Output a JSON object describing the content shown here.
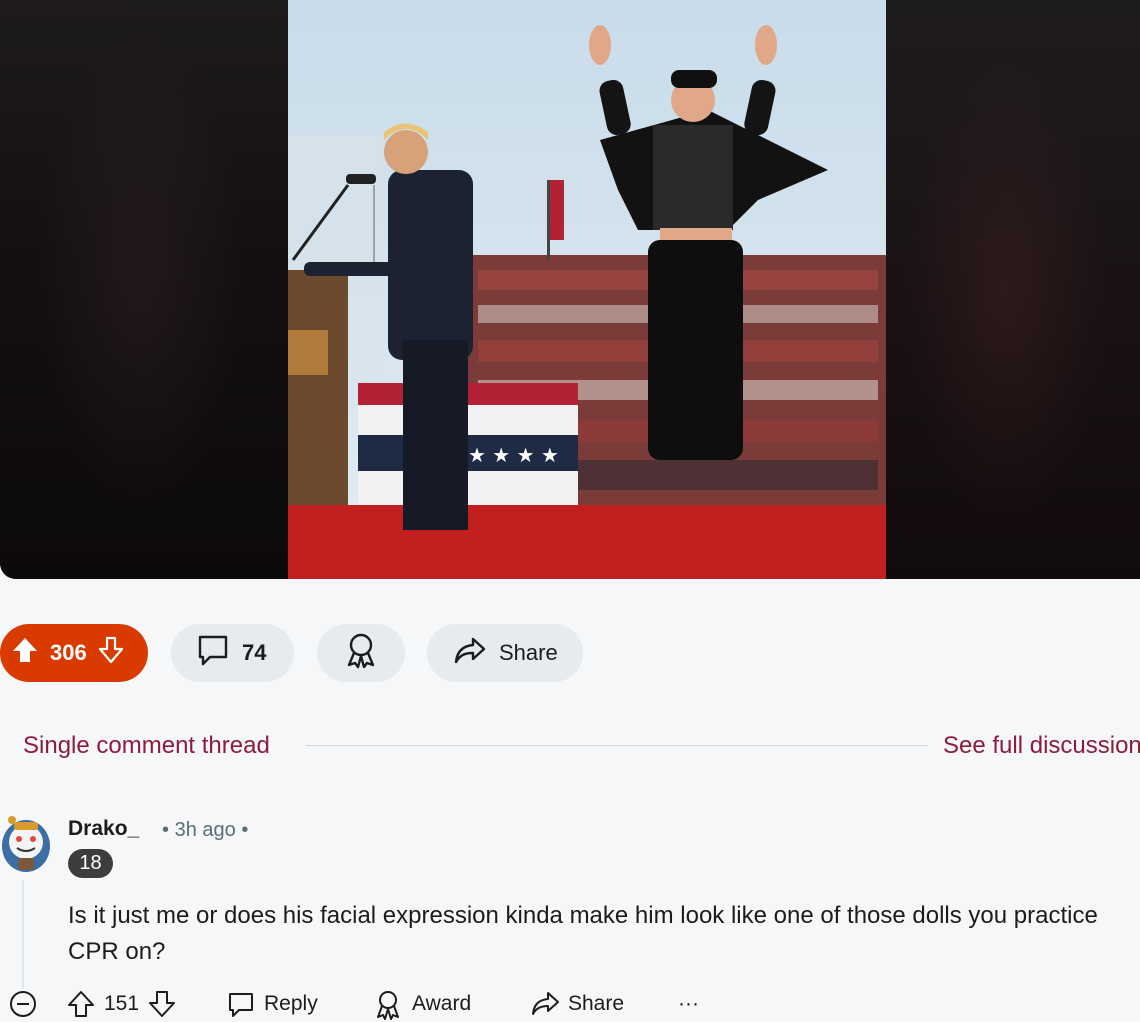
{
  "post": {
    "votes": "306",
    "comments": "74",
    "share_label": "Share"
  },
  "thread": {
    "label": "Single comment thread",
    "see_full": "See full discussion"
  },
  "comment": {
    "author": "Drako_",
    "time": "3h ago",
    "flair": "18",
    "text": "Is it just me or does his facial expression kinda make him look like one of those dolls you practice CPR on?",
    "votes": "151",
    "reply_label": "Reply",
    "award_label": "Award",
    "share_label": "Share",
    "more_label": "···"
  },
  "colors": {
    "upvote_accent": "#d93a00",
    "link": "#8c1d3a"
  },
  "icons": [
    "upvote-icon",
    "downvote-icon",
    "comment-icon",
    "award-icon",
    "share-icon",
    "collapse-icon",
    "more-icon"
  ]
}
